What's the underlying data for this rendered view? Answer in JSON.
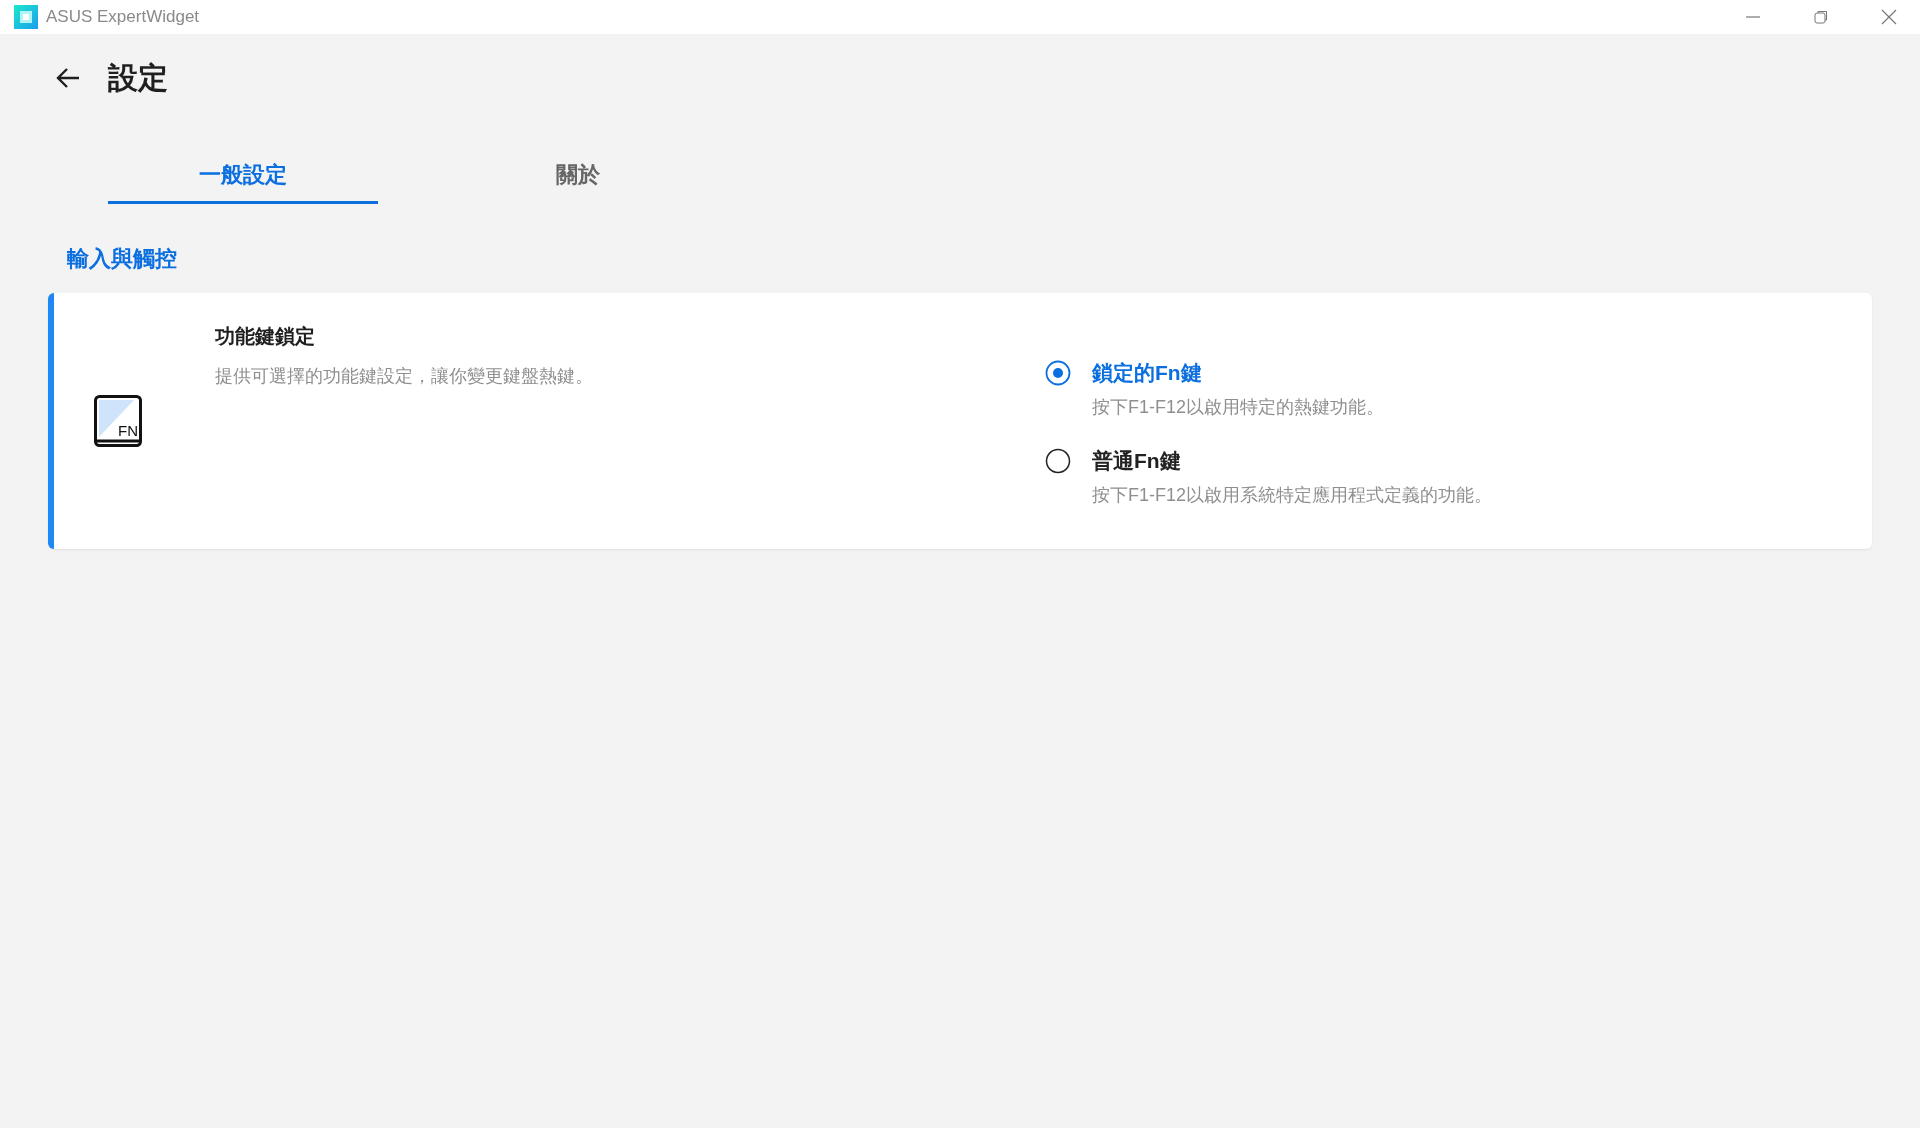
{
  "window": {
    "title": "ASUS ExpertWidget"
  },
  "page": {
    "title": "設定"
  },
  "tabs": [
    {
      "label": "一般設定",
      "selected": true
    },
    {
      "label": "關於",
      "selected": false
    }
  ],
  "section": {
    "title": "輸入與觸控"
  },
  "setting": {
    "icon_label": "FN",
    "title": "功能鍵鎖定",
    "description": "提供可選擇的功能鍵設定，讓你變更鍵盤熱鍵。",
    "options": [
      {
        "label": "鎖定的Fn鍵",
        "description": "按下F1-F12以啟用特定的熱鍵功能。",
        "selected": true
      },
      {
        "label": "普通Fn鍵",
        "description": "按下F1-F12以啟用系統特定應用程式定義的功能。",
        "selected": false
      }
    ]
  }
}
